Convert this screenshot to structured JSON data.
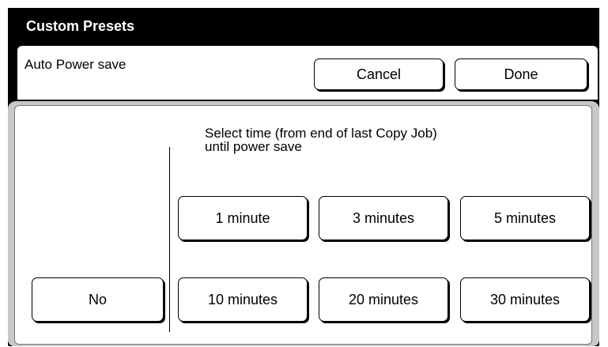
{
  "title": "Custom Presets",
  "header": {
    "label": "Auto Power save",
    "cancel_label": "Cancel",
    "done_label": "Done"
  },
  "prompt": {
    "line1": "Select time (from end of last Copy Job)",
    "line2": "until power save"
  },
  "no_label": "No",
  "options": [
    {
      "label": "1 minute"
    },
    {
      "label": "3 minutes"
    },
    {
      "label": "5 minutes"
    },
    {
      "label": "10 minutes"
    },
    {
      "label": "20 minutes"
    },
    {
      "label": "30 minutes"
    }
  ]
}
